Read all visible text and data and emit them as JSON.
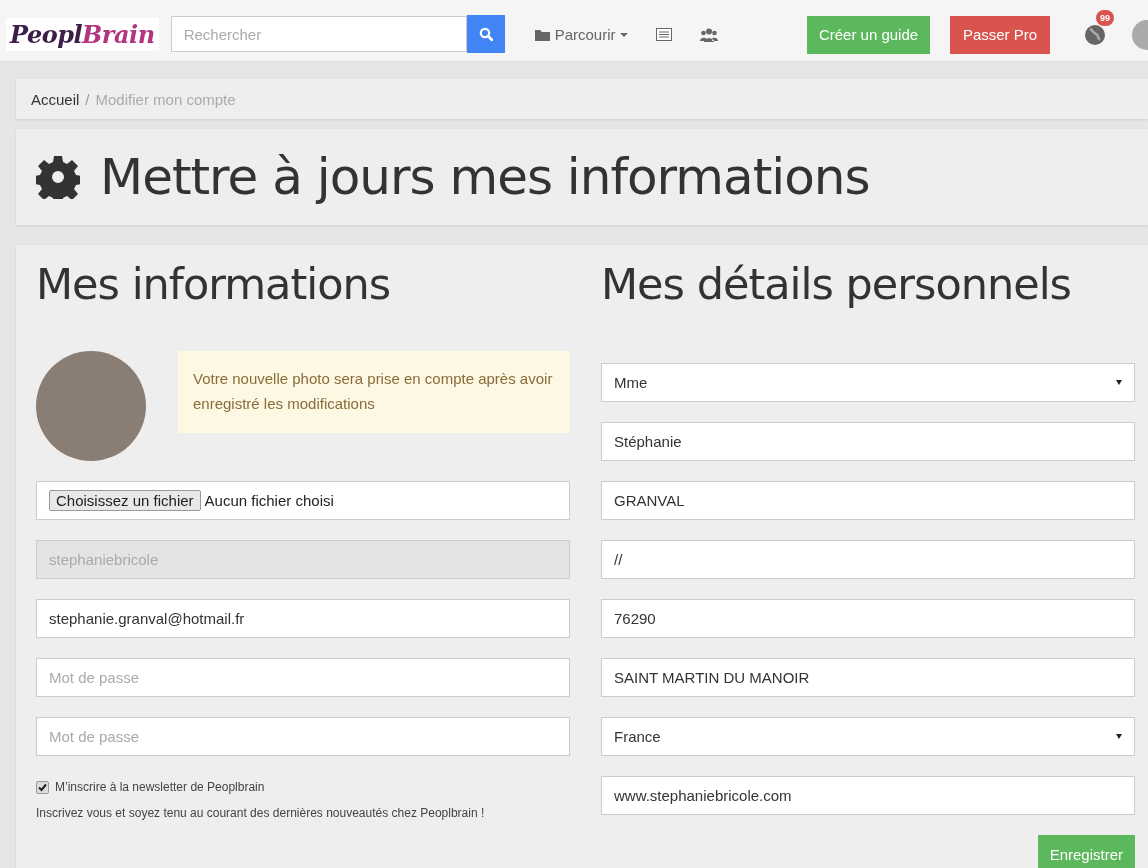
{
  "navbar": {
    "logo": {
      "main": "Peopl",
      "accent": "Brain"
    },
    "search": {
      "placeholder": "Rechercher"
    },
    "browse": {
      "label": "Parcourir"
    },
    "create_button": "Créer un guide",
    "pro_button": "Passer Pro",
    "notifications": {
      "count": "99"
    }
  },
  "breadcrumb_separator": "/",
  "breadcrumb": [
    {
      "label": "Accueil",
      "selected": false
    },
    {
      "label": "Modifier mon compte",
      "selected": true
    }
  ],
  "page_title": "Mettre à jours mes informations",
  "left": {
    "heading": "Mes informations",
    "notice": "Votre nouvelle photo sera prise en compte après avoir enregistré les modifications",
    "file": {
      "button": "Choisissez un fichier",
      "status": "Aucun fichier choisi"
    },
    "fields": [
      {
        "value": "stephaniebricole",
        "disabled": true
      },
      {
        "value": "stephanie.granval@hotmail.fr",
        "disabled": false
      },
      {
        "placeholder": "Mot de passe",
        "disabled": false
      },
      {
        "placeholder": "Mot de passe",
        "disabled": false
      }
    ],
    "newsletter": {
      "label": "M’inscrire à la newsletter de Peoplbrain",
      "checked": true
    },
    "newsletter_hint": "Inscrivez vous et soyez tenu au courant des dernières nouveautés chez Peoplbrain !"
  },
  "right": {
    "heading": "Mes détails personnels",
    "fields": [
      {
        "kind": "select",
        "value": "Mme"
      },
      {
        "kind": "text",
        "value": "Stéphanie"
      },
      {
        "kind": "text",
        "value": "GRANVAL"
      },
      {
        "kind": "text",
        "value": "//"
      },
      {
        "kind": "text",
        "value": "76290"
      },
      {
        "kind": "text",
        "value": "SAINT MARTIN DU MANOIR"
      },
      {
        "kind": "select",
        "value": "France"
      },
      {
        "kind": "text",
        "value": "www.stephaniebricole.com"
      }
    ],
    "save_button": "Enregistrer"
  }
}
